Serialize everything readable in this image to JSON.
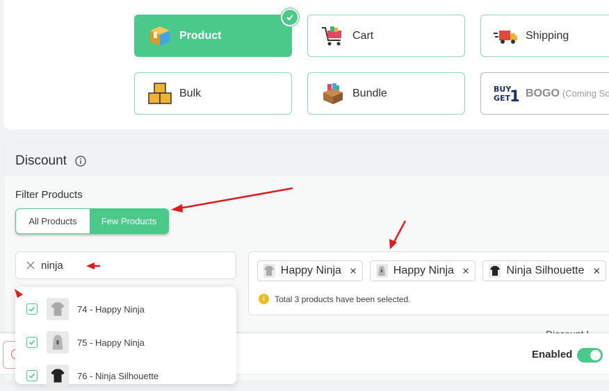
{
  "discount_types": [
    {
      "label": "Product",
      "subtext": "",
      "icon": "product-box-icon",
      "selected": true
    },
    {
      "label": "Cart",
      "subtext": "",
      "icon": "shopping-cart-icon",
      "selected": false
    },
    {
      "label": "Shipping",
      "subtext": "",
      "icon": "delivery-truck-icon",
      "selected": false
    },
    {
      "label": "Bulk",
      "subtext": "",
      "icon": "stacked-boxes-icon",
      "selected": false
    },
    {
      "label": "Bundle",
      "subtext": "",
      "icon": "bundle-box-icon",
      "selected": false
    },
    {
      "label": "BOGO",
      "subtext": "(Coming Soo",
      "icon": "buy-get-1-icon",
      "selected": false
    }
  ],
  "discount": {
    "title": "Discount",
    "filter_label": "Filter Products",
    "filter_options": [
      "All Products",
      "Few Products"
    ],
    "filter_selected": "Few Products",
    "search": {
      "value": "ninja"
    },
    "results": [
      {
        "label": "74 - Happy Ninja",
        "checked": true
      },
      {
        "label": "75 - Happy Ninja",
        "checked": true
      },
      {
        "label": "76 - Ninja Silhouette",
        "checked": true
      }
    ],
    "selected_chips": [
      "Happy Ninja",
      "Happy Ninja",
      "Ninja Silhouette"
    ],
    "total_note": "Total 3 products have been selected.",
    "partially_hidden_label": "Discount L"
  },
  "footer": {
    "enabled_label": "Enabled",
    "enabled": true
  },
  "colors": {
    "accent": "#4ac98a",
    "annotation": "#e01b1b",
    "warning": "#f1bb1c"
  }
}
